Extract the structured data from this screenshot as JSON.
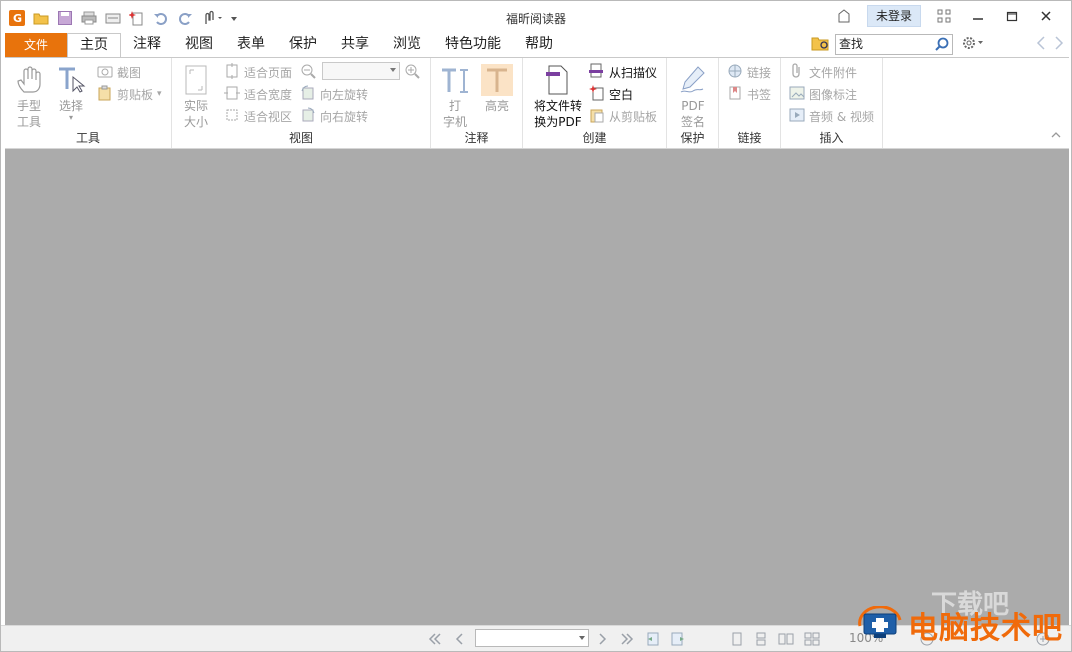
{
  "titlebar": {
    "app_title": "福昕阅读器",
    "login_label": "未登录",
    "qat_icons": [
      "app-logo-icon",
      "open-folder-icon",
      "save-icon",
      "print-icon",
      "scan-icon",
      "new-icon",
      "undo-icon",
      "redo-icon",
      "hand-touch-icon",
      "customize-dropdown-icon"
    ]
  },
  "tabs": {
    "file": "文件",
    "items": [
      "主页",
      "注释",
      "视图",
      "表单",
      "保护",
      "共享",
      "浏览",
      "特色功能",
      "帮助"
    ],
    "active": "主页"
  },
  "search": {
    "value": "查找"
  },
  "ribbon": {
    "tools": {
      "hand": [
        "手型",
        "工具"
      ],
      "select": "选择",
      "screenshot": "截图",
      "clipboard": "剪贴板",
      "label": "工具"
    },
    "view": {
      "actual_size": [
        "实际",
        "大小"
      ],
      "fit_page": "适合页面",
      "fit_width": "适合宽度",
      "fit_visible": "适合视区",
      "rotate_left": "向左旋转",
      "rotate_right": "向右旋转",
      "label": "视图"
    },
    "comment": {
      "typewriter": [
        "打",
        "字机"
      ],
      "highlight": "高亮",
      "label": "注释"
    },
    "create": {
      "convert": [
        "将文件转",
        "换为PDF"
      ],
      "from_scanner": "从扫描仪",
      "blank": "空白",
      "from_clipboard": "从剪贴板",
      "label": "创建"
    },
    "protect": {
      "sign": [
        "PDF",
        "签名"
      ],
      "label": "保护"
    },
    "links": {
      "link": "链接",
      "bookmark": "书签",
      "label": "链接"
    },
    "insert": {
      "attachment": "文件附件",
      "image_annotation": "图像标注",
      "audio_video": "音频 & 视频",
      "label": "插入"
    }
  },
  "statusbar": {
    "zoom_text": "100%"
  },
  "watermark": {
    "text": "电脑技术吧",
    "sub": "下载吧"
  },
  "colors": {
    "file_tab": "#e8730c",
    "doc_bg": "#ababab",
    "login_bg": "#dbe8f7",
    "watermark": "#f06a0a"
  }
}
